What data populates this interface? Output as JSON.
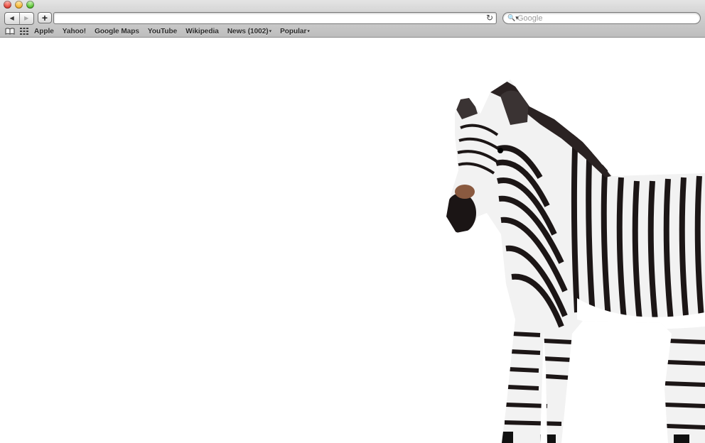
{
  "window": {
    "controls": [
      "close",
      "minimize",
      "zoom"
    ],
    "colors": {
      "close": "#e0443a",
      "minimize": "#f2b232",
      "zoom": "#53bd2f"
    }
  },
  "toolbar": {
    "back_icon": "back-arrow-icon",
    "forward_icon": "forward-arrow-icon",
    "back_label": "◀",
    "forward_label": "▶",
    "add_label": "+",
    "address": {
      "value": ""
    },
    "reload_label": "↻",
    "search": {
      "placeholder": "Google",
      "icon": "magnifier-icon",
      "icon_label": "🔍▾"
    }
  },
  "bookmarks_bar": {
    "reading_list_icon": "book-icon",
    "top_sites_icon": "grid-icon",
    "items": [
      {
        "label": "Apple"
      },
      {
        "label": "Yahoo!"
      },
      {
        "label": "Google Maps"
      },
      {
        "label": "YouTube"
      },
      {
        "label": "Wikipedia"
      },
      {
        "label": "News (1002)",
        "menu": true
      },
      {
        "label": "Popular",
        "menu": true
      }
    ],
    "caret": "▾"
  },
  "page": {
    "background": "#ffffff",
    "image": "grevy-zebra-photo"
  }
}
